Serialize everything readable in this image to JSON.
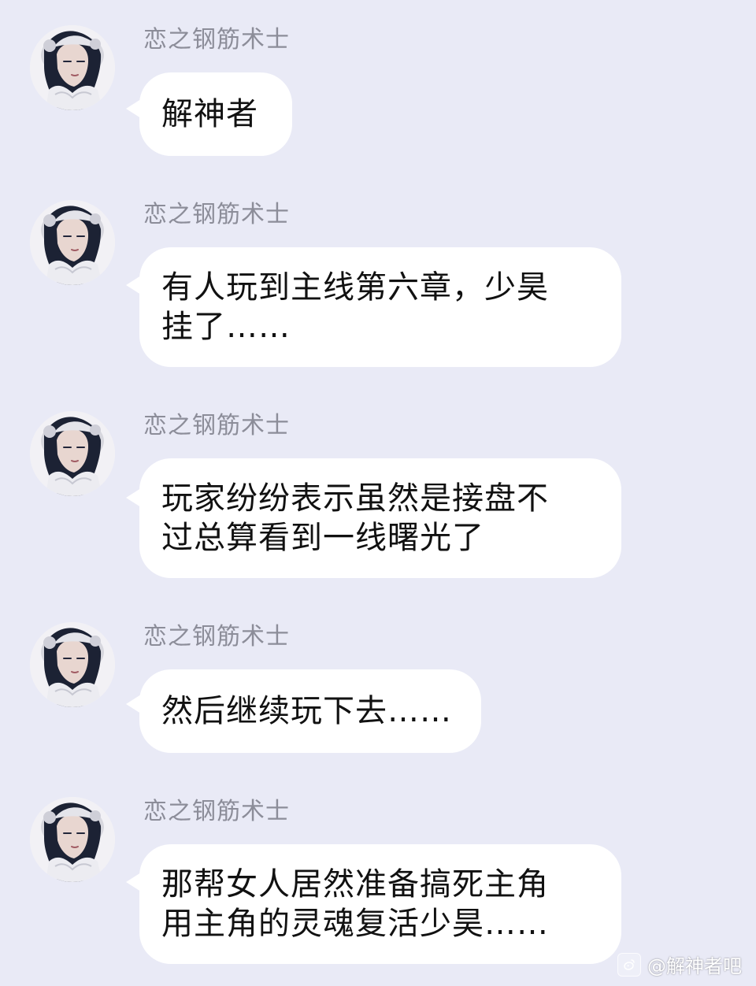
{
  "messages": [
    {
      "sender": "恋之钢筋术士",
      "text": "解神者"
    },
    {
      "sender": "恋之钢筋术士",
      "text": "有人玩到主线第六章，少昊\n挂了……"
    },
    {
      "sender": "恋之钢筋术士",
      "text": "玩家纷纷表示虽然是接盘不\n过总算看到一线曙光了"
    },
    {
      "sender": "恋之钢筋术士",
      "text": "然后继续玩下去……"
    },
    {
      "sender": "恋之钢筋术士",
      "text": "那帮女人居然准备搞死主角\n用主角的灵魂复活少昊……"
    }
  ],
  "watermark": {
    "icon": "weibo-icon",
    "text": "@解神者吧"
  },
  "colors": {
    "background": "#e9eaf6",
    "bubble": "#ffffff",
    "sender": "#8c8d99",
    "text": "#111111"
  }
}
